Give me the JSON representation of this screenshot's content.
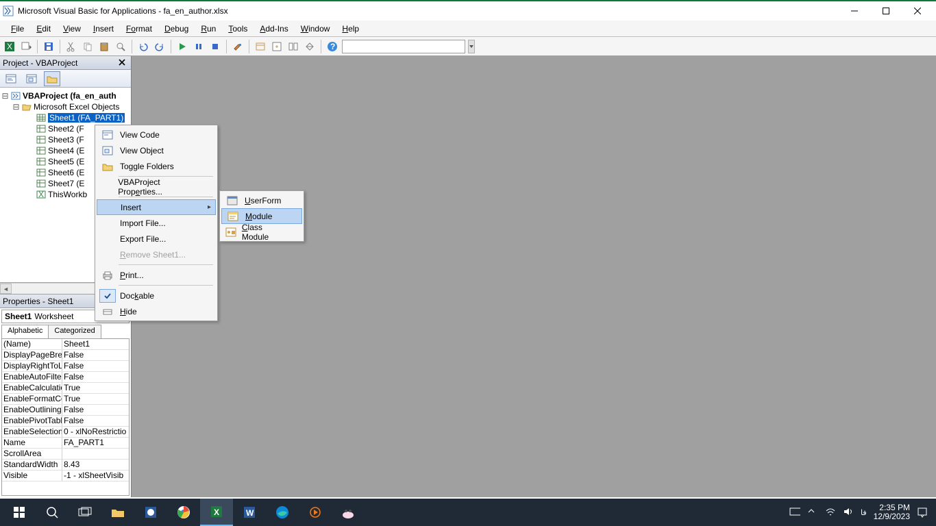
{
  "title": "Microsoft Visual Basic for Applications - fa_en_author.xlsx",
  "menubar": [
    "File",
    "Edit",
    "View",
    "Insert",
    "Format",
    "Debug",
    "Run",
    "Tools",
    "Add-Ins",
    "Window",
    "Help"
  ],
  "project_panel": {
    "title": "Project - VBAProject",
    "root": "VBAProject (fa_en_auth",
    "folder": "Microsoft Excel Objects",
    "items": [
      "Sheet1 (FA_PART1)",
      "Sheet2 (F",
      "Sheet3 (F",
      "Sheet4 (E",
      "Sheet5 (E",
      "Sheet6 (E",
      "Sheet7 (E",
      "ThisWorkb"
    ]
  },
  "properties_panel": {
    "title": "Properties - Sheet1",
    "obj_name": "Sheet1",
    "obj_type": "Worksheet",
    "tabs": [
      "Alphabetic",
      "Categorized"
    ],
    "rows": [
      {
        "k": "(Name)",
        "v": "Sheet1"
      },
      {
        "k": "DisplayPageBreak",
        "v": "False"
      },
      {
        "k": "DisplayRightToLef",
        "v": "False"
      },
      {
        "k": "EnableAutoFilter",
        "v": "False"
      },
      {
        "k": "EnableCalculation",
        "v": "True"
      },
      {
        "k": "EnableFormatCon",
        "v": "True"
      },
      {
        "k": "EnableOutlining",
        "v": "False"
      },
      {
        "k": "EnablePivotTable",
        "v": "False"
      },
      {
        "k": "EnableSelection",
        "v": "0 - xlNoRestrictio"
      },
      {
        "k": "Name",
        "v": "FA_PART1"
      },
      {
        "k": "ScrollArea",
        "v": ""
      },
      {
        "k": "StandardWidth",
        "v": "8.43"
      },
      {
        "k": "Visible",
        "v": "-1 - xlSheetVisib"
      }
    ]
  },
  "context_menu": {
    "items": [
      {
        "label": "View Code",
        "icon": "code"
      },
      {
        "label": "View Object",
        "icon": "grid"
      },
      {
        "label": "Toggle Folders",
        "icon": "folder"
      },
      {
        "label": "VBAProject Properties...",
        "sep_before": false
      },
      {
        "label": "Insert",
        "submenu": true,
        "highlight": true
      },
      {
        "label": "Import File..."
      },
      {
        "label": "Export File..."
      },
      {
        "label": "Remove Sheet1...",
        "disabled": true
      },
      {
        "label": "Print...",
        "icon": "print"
      },
      {
        "label": "Dockable",
        "checked": true
      },
      {
        "label": "Hide"
      }
    ]
  },
  "insert_submenu": [
    "UserForm",
    "Module",
    "Class Module"
  ],
  "taskbar": {
    "time": "2:35 PM",
    "date": "12/9/2023",
    "lang": "فا"
  }
}
